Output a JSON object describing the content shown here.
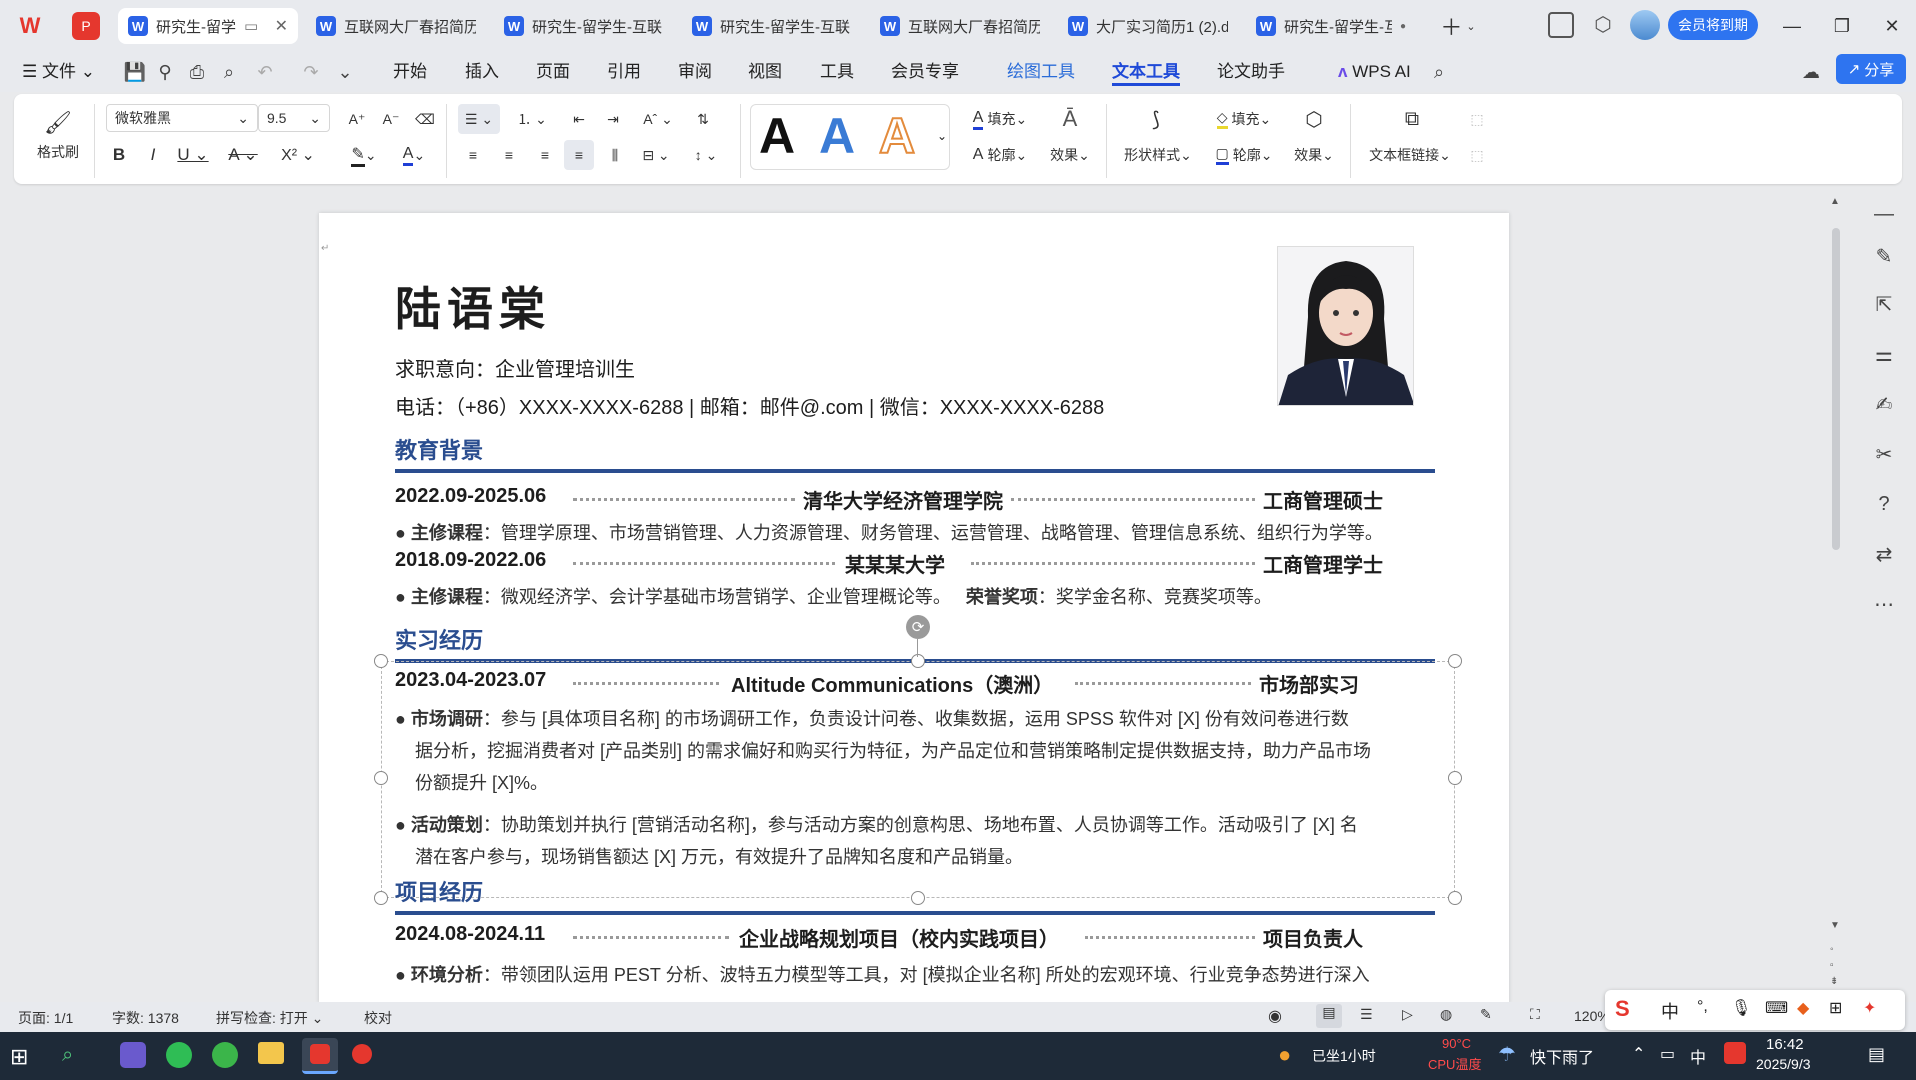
{
  "tabs": [
    {
      "label": "研究生-留学",
      "active": true
    },
    {
      "label": "互联网大厂春招简历"
    },
    {
      "label": "研究生-留学生-互联"
    },
    {
      "label": "研究生-留学生-互联"
    },
    {
      "label": "互联网大厂春招简历"
    },
    {
      "label": "大厂实习简历1 (2).d"
    },
    {
      "label": "研究生-留学生-互"
    }
  ],
  "member_badge": "会员将到期",
  "menu": {
    "file": "文件",
    "items": [
      "开始",
      "插入",
      "页面",
      "引用",
      "审阅",
      "视图",
      "工具",
      "会员专享",
      "绘图工具",
      "文本工具",
      "论文助手"
    ],
    "wps_ai": "WPS AI",
    "share": "分享"
  },
  "ribbon": {
    "format_painter": "格式刷",
    "font": "微软雅黑",
    "font_size": "9.5",
    "fill": "填充",
    "outline": "轮廓",
    "effect": "效果",
    "shape_style": "形状样式",
    "fill2": "填充",
    "outline2": "轮廓",
    "effect2": "效果",
    "textbox_link": "文本框链接",
    "style_glyph": "A"
  },
  "resume": {
    "name": "陆语棠",
    "objective": "求职意向：企业管理培训生",
    "contact": "电话：（+86）XXXX-XXXX-6288 | 邮箱：邮件@.com | 微信：XXXX-XXXX-6288",
    "edu_title": "教育背景",
    "edu1_date": "2022.09-2025.06",
    "edu1_school": "清华大学经济管理学院",
    "edu1_degree": "工商管理硕士",
    "edu1_course_label": "主修课程",
    "edu1_course": "：管理学原理、市场营销管理、人力资源管理、财务管理、运营管理、战略管理、管理信息系统、组织行为学等。",
    "edu2_date": "2018.09-2022.06",
    "edu2_school": "某某某大学",
    "edu2_degree": "工商管理学士",
    "edu2_course_label": "主修课程",
    "edu2_course": "：微观经济学、会计学基础市场营销学、企业管理概论等。",
    "edu2_honor_label": "荣誉奖项",
    "edu2_honor": "：奖学金名称、竞赛奖项等。",
    "intern_title": "实习经历",
    "intern_date": "2023.04-2023.07",
    "intern_company": "Altitude Communications（澳洲）",
    "intern_role": "市场部实习",
    "intern_b1_label": "市场调研",
    "intern_b1_l1": "：参与 [具体项目名称] 的市场调研工作，负责设计问卷、收集数据，运用 SPSS 软件对 [X] 份有效问卷进行数",
    "intern_b1_l2": "据分析，挖掘消费者对 [产品类别] 的需求偏好和购买行为特征，为产品定位和营销策略制定提供数据支持，助力产品市场",
    "intern_b1_l3": "份额提升 [X]%。",
    "intern_b2_label": "活动策划",
    "intern_b2_l1": "：协助策划并执行 [营销活动名称]，参与活动方案的创意构思、场地布置、人员协调等工作。活动吸引了 [X] 名",
    "intern_b2_l2": "潜在客户参与，现场销售额达 [X] 万元，有效提升了品牌知名度和产品销量。",
    "project_title": "项目经历",
    "project_date": "2024.08-2024.11",
    "project_name": "企业战略规划项目（校内实践项目）",
    "project_role": "项目负责人",
    "project_b1_label": "环境分析",
    "project_b1_l1": "：带领团队运用 PEST 分析、波特五力模型等工具，对 [模拟企业名称] 所处的宏观环境、行业竞争态势进行深入"
  },
  "status": {
    "page": "页面: 1/1",
    "words": "字数: 1378",
    "spell": "拼写检查: 打开",
    "proof": "校对",
    "zoom": "120%"
  },
  "ime": {
    "zh": "中"
  },
  "taskbar": {
    "weather": "快下雨了",
    "sitting": "已坐1小时",
    "temp": "90°C",
    "cpu": "CPU温度",
    "time": "16:42",
    "date": "2025/9/3",
    "lang": "中"
  },
  "colors": {
    "accent": "#2a4d8f",
    "brand": "#1f4ad8",
    "wps_red": "#e5372e"
  }
}
